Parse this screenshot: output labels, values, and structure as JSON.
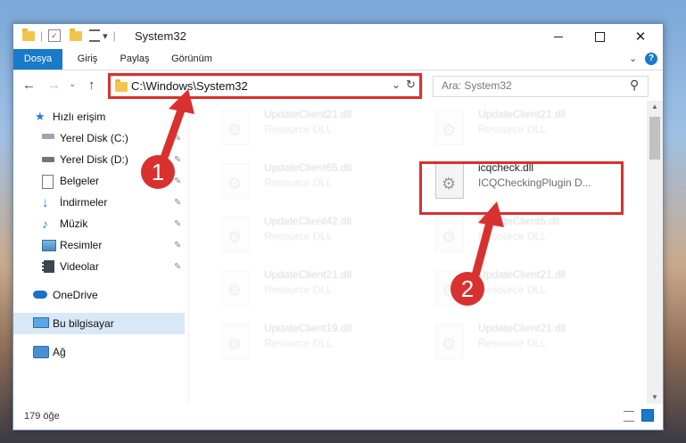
{
  "window": {
    "title": "System32",
    "quick_access": {
      "dropdown": "▾",
      "separator": "|"
    }
  },
  "ribbon": {
    "tabs": [
      "Dosya",
      "Giriş",
      "Paylaş",
      "Görünüm"
    ],
    "help": "?"
  },
  "navigation": {
    "back": "←",
    "forward": "→",
    "recent": "⌄",
    "up": "↑",
    "address": "C:\\Windows\\System32",
    "address_dropdown": "⌄",
    "refresh": "↻",
    "search_placeholder": "Ara: System32",
    "search_icon": "⚲"
  },
  "sidebar": {
    "quick_access_label": "Hızlı erişim",
    "items": [
      {
        "label": "Yerel Disk (C:)",
        "icon": "drive-icon",
        "pinned": true
      },
      {
        "label": "Yerel Disk (D:)",
        "icon": "drive-icon",
        "pinned": true
      },
      {
        "label": "Belgeler",
        "icon": "documents-icon",
        "pinned": true
      },
      {
        "label": "İndirmeler",
        "icon": "download-icon",
        "pinned": true
      },
      {
        "label": "Müzik",
        "icon": "music-icon",
        "pinned": true
      },
      {
        "label": "Resimler",
        "icon": "pictures-icon",
        "pinned": true
      },
      {
        "label": "Videolar",
        "icon": "videos-icon",
        "pinned": true
      }
    ],
    "onedrive": "OneDrive",
    "this_pc": "Bu bilgisayar",
    "network": "Ağ",
    "pin_glyph": "📌"
  },
  "files": [
    {
      "name": "UpdateClient21.dll",
      "desc": "Resource DLL"
    },
    {
      "name": "UpdateClient21.dll",
      "desc": "Resource DLL"
    },
    {
      "name": "UpdateClient65.dll",
      "desc": "Resource DLL"
    },
    {
      "name": "icqcheck.dll",
      "desc": "ICQCheckingPlugin D..."
    },
    {
      "name": "UpdateClient42.dll",
      "desc": "Resource DLL"
    },
    {
      "name": "UpdateClient5.dll",
      "desc": "Resource DLL"
    },
    {
      "name": "UpdateClient21.dll",
      "desc": "Resource DLL"
    },
    {
      "name": "UpdateClient21.dll",
      "desc": "Resource DLL"
    },
    {
      "name": "UpdateClient19.dll",
      "desc": "Resource DLL"
    },
    {
      "name": "UpdateClient21.dll",
      "desc": "Resource DLL"
    }
  ],
  "status": {
    "count": "179 öğe"
  },
  "annotations": {
    "step1": "1",
    "step2": "2",
    "highlight_color": "#d9312f"
  },
  "colors": {
    "file_tab": "#1979ca",
    "selected": "#d9e8f7"
  }
}
